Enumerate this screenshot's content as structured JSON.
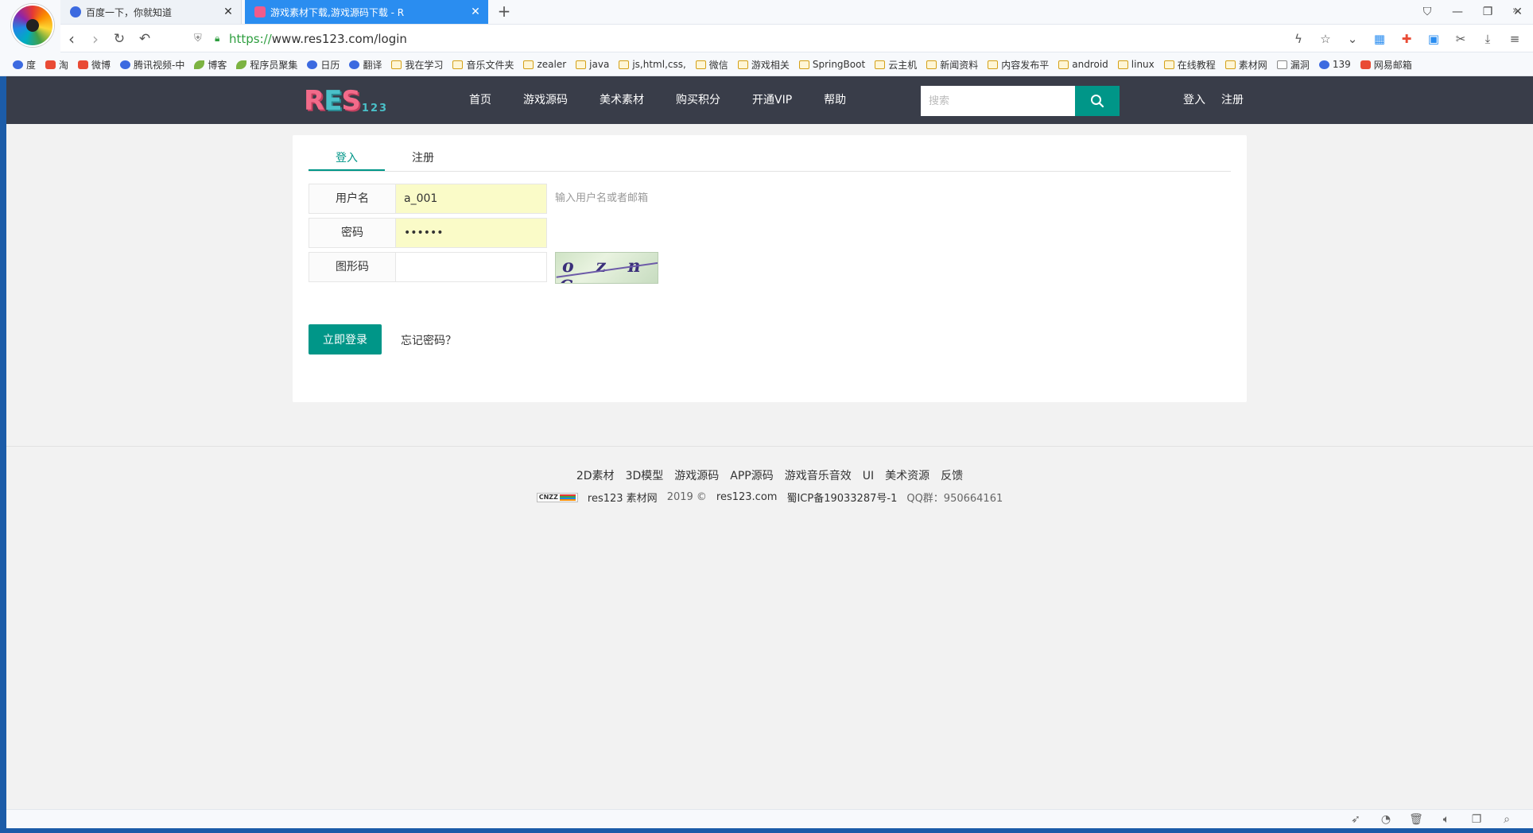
{
  "browser": {
    "tabs": [
      {
        "title": "百度一下，你就知道",
        "active": false
      },
      {
        "title": "游戏素材下载,游戏源码下载 - R",
        "active": true
      }
    ],
    "new_tab_label": "+",
    "url_scheme": "https://",
    "url_rest": "www.res123.com/login",
    "window_controls": [
      "⛉",
      "—",
      "❐",
      "✕"
    ],
    "bookmarks": [
      {
        "label": "度",
        "icon": "site"
      },
      {
        "label": "淘",
        "icon": "red"
      },
      {
        "label": "微博",
        "icon": "red"
      },
      {
        "label": "腾讯视频-中",
        "icon": "site"
      },
      {
        "label": "博客",
        "icon": "leaf"
      },
      {
        "label": "程序员聚集",
        "icon": "leaf"
      },
      {
        "label": "日历",
        "icon": "site"
      },
      {
        "label": "翻译",
        "icon": "site"
      },
      {
        "label": "我在学习",
        "icon": "folder"
      },
      {
        "label": "音乐文件夹",
        "icon": "folder"
      },
      {
        "label": "zealer",
        "icon": "folder"
      },
      {
        "label": "java",
        "icon": "folder"
      },
      {
        "label": "js,html,css,",
        "icon": "folder"
      },
      {
        "label": "微信",
        "icon": "folder"
      },
      {
        "label": "游戏相关",
        "icon": "folder"
      },
      {
        "label": "SpringBoot",
        "icon": "folder"
      },
      {
        "label": "云主机",
        "icon": "folder"
      },
      {
        "label": "新闻资料",
        "icon": "folder"
      },
      {
        "label": "内容发布平",
        "icon": "folder"
      },
      {
        "label": "android",
        "icon": "folder"
      },
      {
        "label": "linux",
        "icon": "folder"
      },
      {
        "label": "在线教程",
        "icon": "folder"
      },
      {
        "label": "素材网",
        "icon": "folder"
      },
      {
        "label": "漏洞",
        "icon": "doc"
      },
      {
        "label": "139",
        "icon": "site"
      },
      {
        "label": "网易邮箱",
        "icon": "red"
      }
    ],
    "bookmarks_more": "»"
  },
  "site": {
    "logo_big": "RES",
    "logo_small": "123",
    "nav": [
      "首页",
      "游戏源码",
      "美术素材",
      "购买积分",
      "开通VIP",
      "帮助"
    ],
    "search_placeholder": "搜索",
    "login_link": "登入",
    "register_link": "注册"
  },
  "login": {
    "tabs": [
      {
        "label": "登入",
        "active": true
      },
      {
        "label": "注册",
        "active": false
      }
    ],
    "username_label": "用户名",
    "username_value": "a_001",
    "username_tip": "输入用户名或者邮箱",
    "password_label": "密码",
    "password_value": "••••••",
    "captcha_label": "图形码",
    "captcha_value": "",
    "captcha_text": "o z n C",
    "submit_label": "立即登录",
    "forgot_label": "忘记密码？"
  },
  "footer": {
    "links": [
      "2D素材",
      "3D模型",
      "游戏源码",
      "APP源码",
      "游戏音乐音效",
      "UI",
      "美术资源",
      "反馈"
    ],
    "cnzz": "CNZZ",
    "site_name": "res123 素材网",
    "year": "2019 ©",
    "domain": "res123.com",
    "icp": "蜀ICP备19033287号-1",
    "qq": "QQ群：950664161"
  },
  "colors": {
    "header_bg": "#393d49",
    "accent": "#009688",
    "tab_active": "#2a8df0",
    "autofill": "#fafbc8"
  }
}
